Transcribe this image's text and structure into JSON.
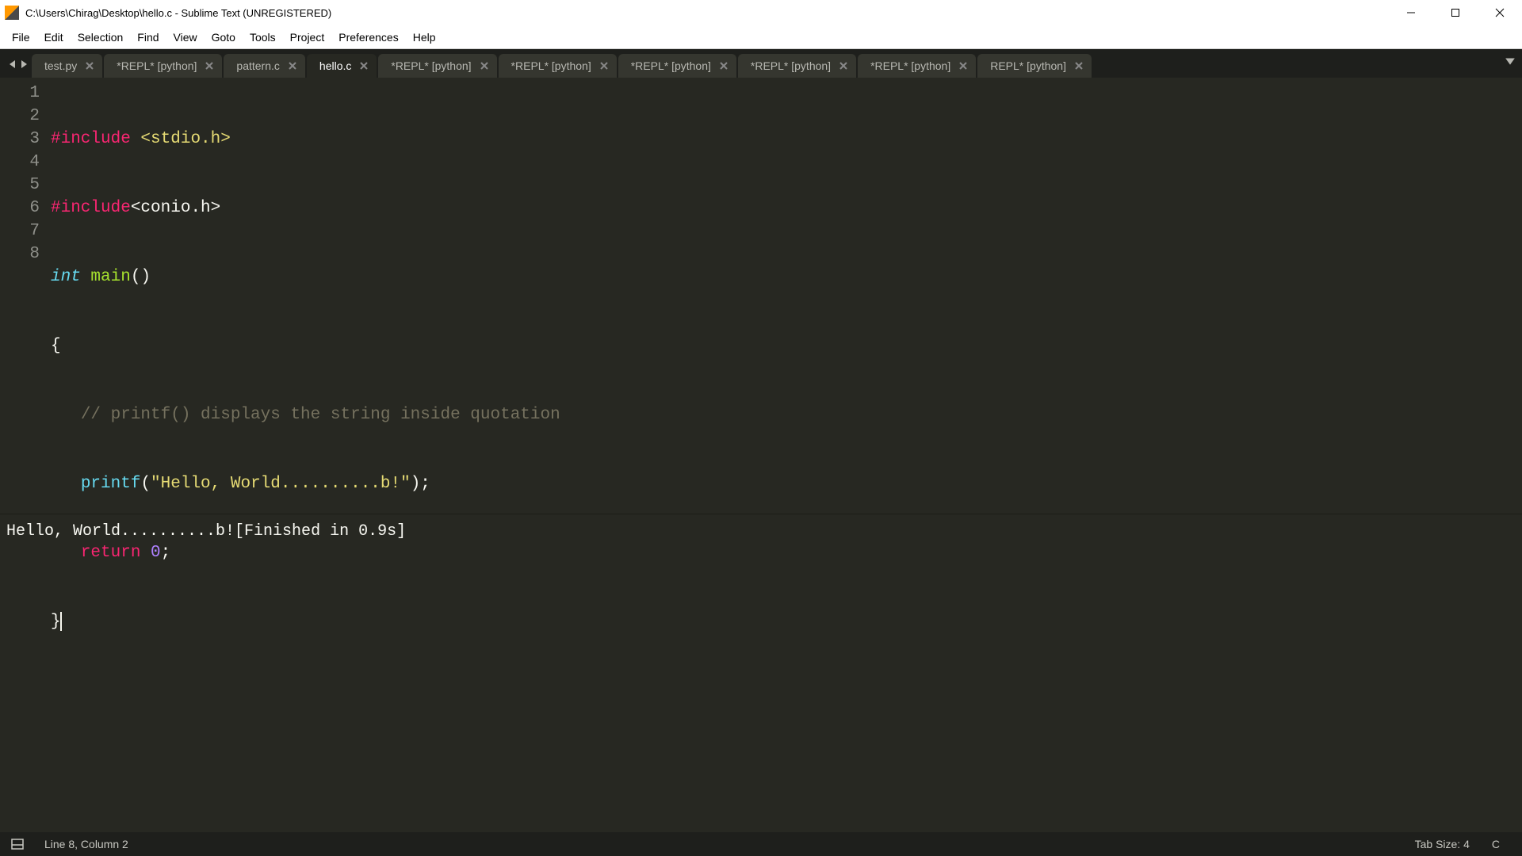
{
  "window": {
    "title": "C:\\Users\\Chirag\\Desktop\\hello.c - Sublime Text (UNREGISTERED)"
  },
  "menu": {
    "items": [
      "File",
      "Edit",
      "Selection",
      "Find",
      "View",
      "Goto",
      "Tools",
      "Project",
      "Preferences",
      "Help"
    ]
  },
  "tabs": [
    {
      "label": "test.py",
      "active": false
    },
    {
      "label": "*REPL* [python]",
      "active": false
    },
    {
      "label": "pattern.c",
      "active": false
    },
    {
      "label": "hello.c",
      "active": true
    },
    {
      "label": "*REPL* [python]",
      "active": false
    },
    {
      "label": "*REPL* [python]",
      "active": false
    },
    {
      "label": "*REPL* [python]",
      "active": false
    },
    {
      "label": "*REPL* [python]",
      "active": false
    },
    {
      "label": "*REPL* [python]",
      "active": false
    },
    {
      "label": "REPL* [python]",
      "active": false
    }
  ],
  "code": {
    "l1_include": "#include",
    "l1_hdr": " <stdio.h>",
    "l2_include": "#include",
    "l2_hdr": "<conio.h>",
    "l3_type": "int",
    "l3_sp": " ",
    "l3_func": "main",
    "l3_paren": "()",
    "l4": "{",
    "l5_indent": "   ",
    "l5_comm": "// printf() displays the string inside quotation",
    "l6_indent": "   ",
    "l6_call": "printf",
    "l6_open": "(",
    "l6_str": "\"Hello, World..........b!\"",
    "l6_close": ");",
    "l7_indent": "   ",
    "l7_ret": "return",
    "l7_sp": " ",
    "l7_num": "0",
    "l7_semi": ";",
    "l8": "}"
  },
  "line_numbers": [
    "1",
    "2",
    "3",
    "4",
    "5",
    "6",
    "7",
    "8"
  ],
  "output": "Hello, World..........b![Finished in 0.9s]",
  "status": {
    "position": "Line 8, Column 2",
    "tab_size": "Tab Size: 4",
    "syntax": "C"
  }
}
